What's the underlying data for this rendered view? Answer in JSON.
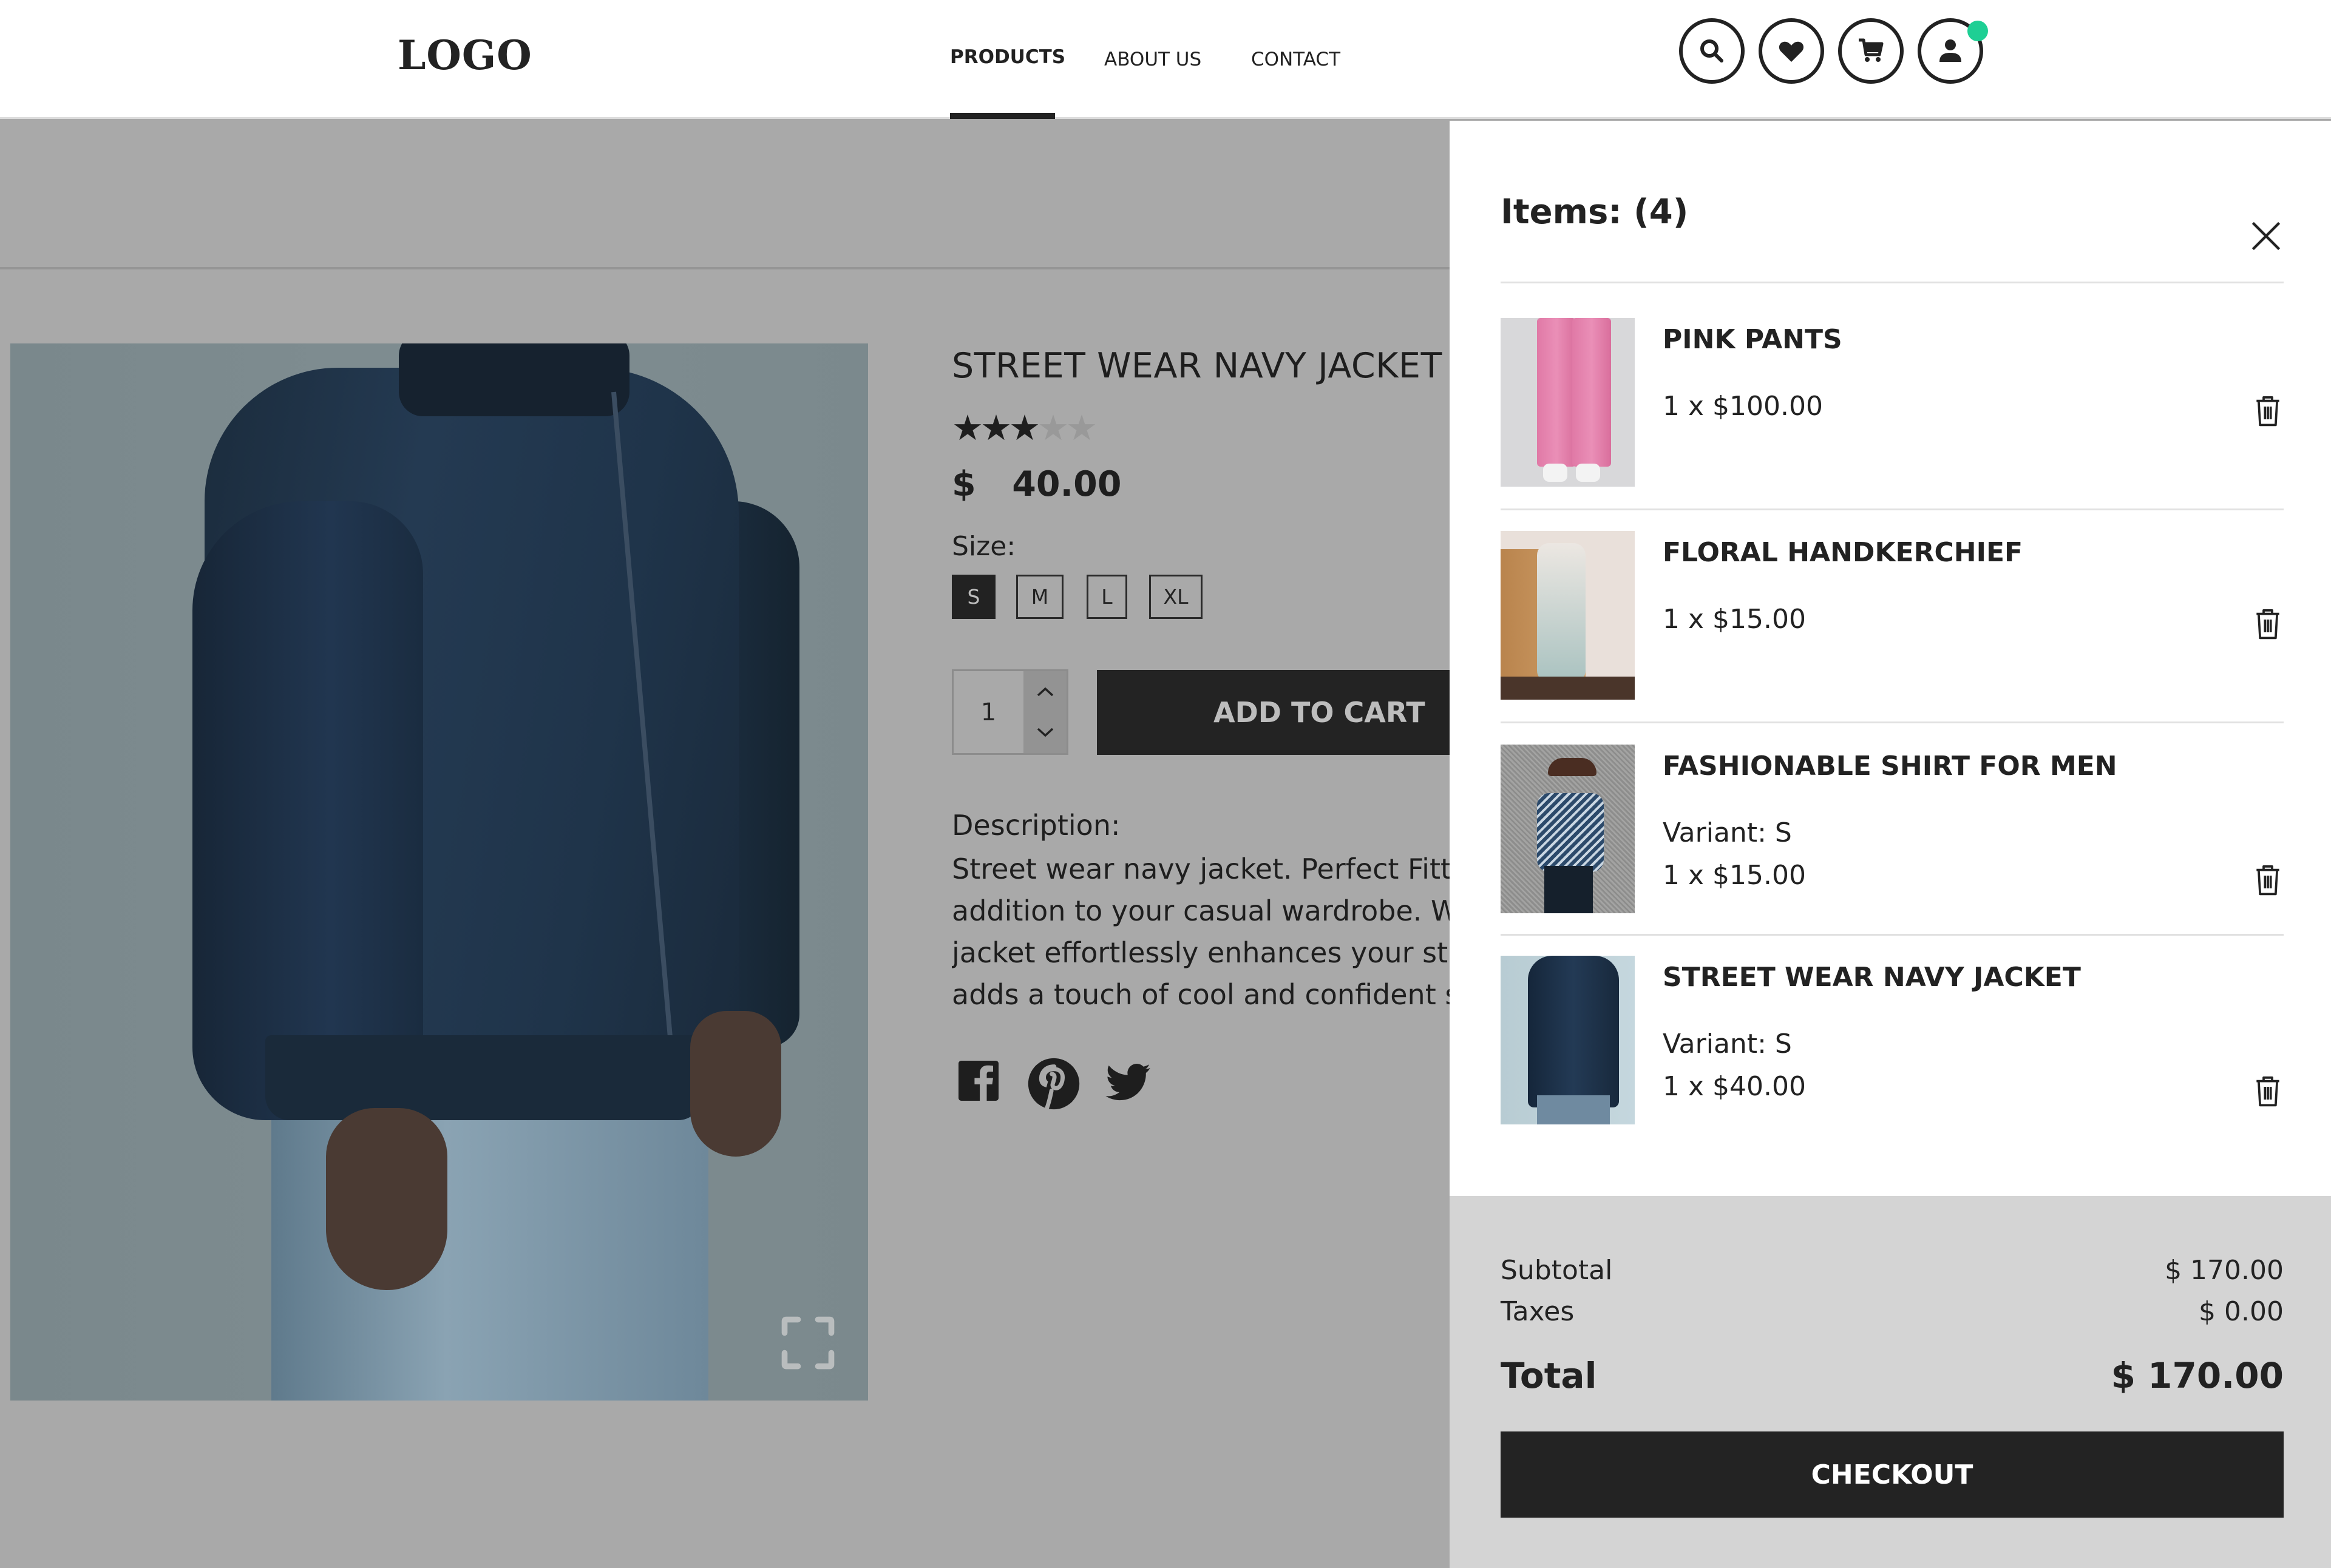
{
  "header": {
    "logo": "LOGO",
    "nav": [
      {
        "label": "PRODUCTS",
        "active": true
      },
      {
        "label": "ABOUT US",
        "active": false
      },
      {
        "label": "CONTACT",
        "active": false
      }
    ],
    "icons": [
      "search-icon",
      "heart-icon",
      "cart-icon",
      "user-icon"
    ],
    "notification_color": "#1ecf94"
  },
  "product": {
    "title": "STREET WEAR NAVY JACKET",
    "rating": 3,
    "rating_max": 5,
    "price": "$   40.00",
    "size_label": "Size:",
    "sizes": [
      {
        "label": "S",
        "selected": true
      },
      {
        "label": "M",
        "selected": false
      },
      {
        "label": "L",
        "selected": false
      },
      {
        "label": "XL",
        "selected": false
      }
    ],
    "quantity": "1",
    "add_to_cart_label": "ADD TO CART",
    "description_label": "Description:",
    "description_lines": [
      "Street wear navy jacket. Perfect Fitting",
      "addition to your casual wardrobe. With",
      "jacket effortlessly enhances your stree",
      "adds a touch of cool and confident sty"
    ],
    "social": [
      "facebook-icon",
      "pinterest-icon",
      "twitter-icon"
    ]
  },
  "cart": {
    "title": "Items: (4)",
    "items": [
      {
        "name": "PINK PANTS",
        "variant": "",
        "qty_price": "1 x $100.00"
      },
      {
        "name": "FLORAL HANDKERCHIEF",
        "variant": "",
        "qty_price": "1 x $15.00"
      },
      {
        "name": "FASHIONABLE SHIRT FOR MEN",
        "variant": "Variant: S",
        "qty_price": "1 x $15.00"
      },
      {
        "name": "STREET WEAR NAVY JACKET",
        "variant": "Variant: S",
        "qty_price": "1 x $40.00"
      }
    ],
    "summary": {
      "subtotal_label": "Subtotal",
      "subtotal_value": "$ 170.00",
      "taxes_label": "Taxes",
      "taxes_value": "$ 0.00",
      "total_label": "Total",
      "total_value": "$ 170.00"
    },
    "checkout_label": "CHECKOUT"
  }
}
